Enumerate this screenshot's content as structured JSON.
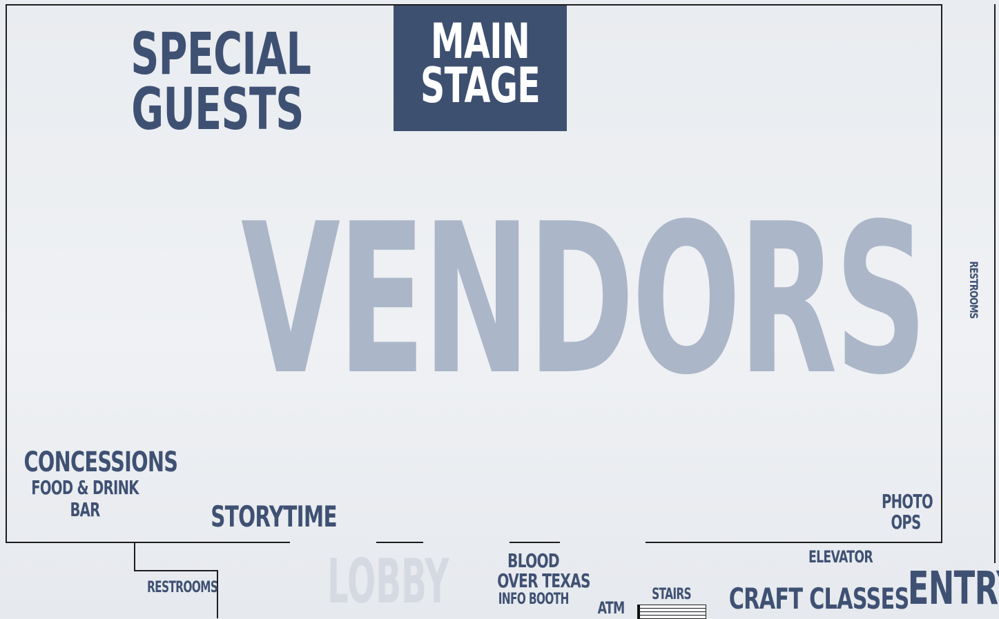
{
  "areas": {
    "special_guests": [
      "SPECIAL",
      "GUESTS"
    ],
    "main_stage": [
      "MAIN",
      "STAGE"
    ],
    "vendors": "VENDORS",
    "concessions": "CONCESSIONS",
    "food_drink": "FOOD & DRINK",
    "bar": "BAR",
    "storytime": "STORYTIME",
    "photo_ops": [
      "PHOTO",
      "OPS"
    ],
    "restrooms_right": "RESTROOMS",
    "restrooms_left": "RESTROOMS",
    "lobby": "LOBBY",
    "blood_over_texas": [
      "BLOOD",
      "OVER TEXAS"
    ],
    "info_booth": "INFO BOOTH",
    "atm": "ATM",
    "stairs": "STAIRS",
    "craft_classes": "CRAFT CLASSES",
    "elevator": "ELEVATOR",
    "entry": "ENTRY"
  },
  "colors": {
    "navy": "#3e5070",
    "vendors": "#abb6c8",
    "lobby": "#d5d9e1",
    "wall": "#1d1d1d"
  }
}
